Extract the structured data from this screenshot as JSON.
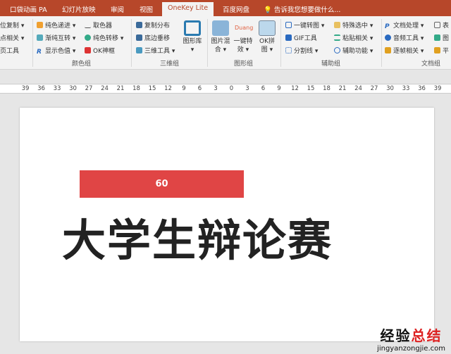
{
  "tabs": [
    "口袋动画 PA",
    "幻灯片放映",
    "审阅",
    "视图",
    "OneKey Lite",
    "百度网盘"
  ],
  "tell_me": "告诉我您想要做什么...",
  "ribbon": {
    "left_partial": [
      "位复制 ▾",
      "点相关 ▾",
      "页工具"
    ],
    "color_group": {
      "label": "颜色组",
      "items": [
        "纯色递进 ▾",
        "渐纯互转 ▾",
        "显示色值 ▾",
        "取色器",
        "纯色转移 ▾",
        "OK神框"
      ]
    },
    "3d_group": {
      "label": "三维组",
      "items": [
        "复制分布",
        "底边垂移",
        "三维工具 ▾"
      ],
      "big": "图形库 ▾"
    },
    "shape_group": {
      "label": "图形组",
      "big": [
        "图片混合 ▾",
        "一键特效 ▾",
        "OK拼图 ▾"
      ],
      "duang": "Duang"
    },
    "aux_group": {
      "label": "辅助组",
      "items": [
        "一键转图 ▾",
        "GIF工具",
        "分割线 ▾",
        "特殊选中 ▾",
        "粘贴相关 ▾",
        "辅助功能 ▾"
      ]
    },
    "doc_group": {
      "label": "文档组",
      "items": [
        "文档处理 ▾",
        "音频工具 ▾",
        "逐帧相关 ▾",
        "表",
        "图",
        "平"
      ]
    }
  },
  "ruler": [
    "39",
    "36",
    "33",
    "30",
    "27",
    "24",
    "21",
    "18",
    "15",
    "12",
    "9",
    "6",
    "3",
    "0",
    "3",
    "6",
    "9",
    "12",
    "15",
    "18",
    "21",
    "24",
    "27",
    "30",
    "33",
    "36",
    "39"
  ],
  "slide": {
    "bar_value": "60",
    "title": "大学生辩论赛"
  },
  "watermark": {
    "line1a": "经验",
    "line1b": "总结",
    "line2": "jingyanzongjie.com"
  }
}
